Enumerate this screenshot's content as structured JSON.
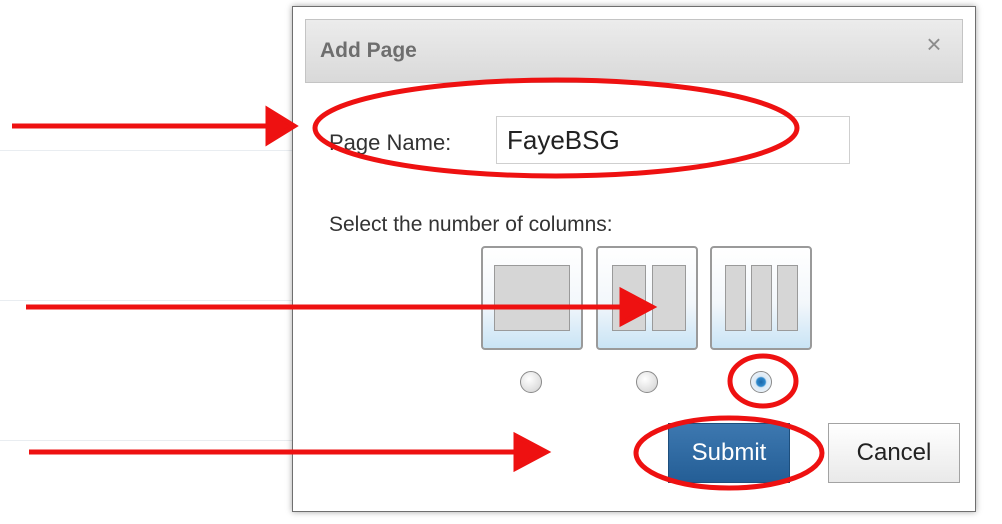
{
  "dialog": {
    "title": "Add Page",
    "close_icon": "close-icon",
    "page_name": {
      "label": "Page Name:",
      "value": "FayeBSG"
    },
    "columns": {
      "label": "Select the number of columns:",
      "options": [
        {
          "columns": 1,
          "selected": false
        },
        {
          "columns": 2,
          "selected": false
        },
        {
          "columns": 3,
          "selected": true
        }
      ]
    },
    "buttons": {
      "submit_label": "Submit",
      "cancel_label": "Cancel"
    }
  },
  "colors": {
    "annotation": "#ee1111",
    "submit_bg": "#2f6aa3",
    "header_bg": "#e3e3e3"
  }
}
